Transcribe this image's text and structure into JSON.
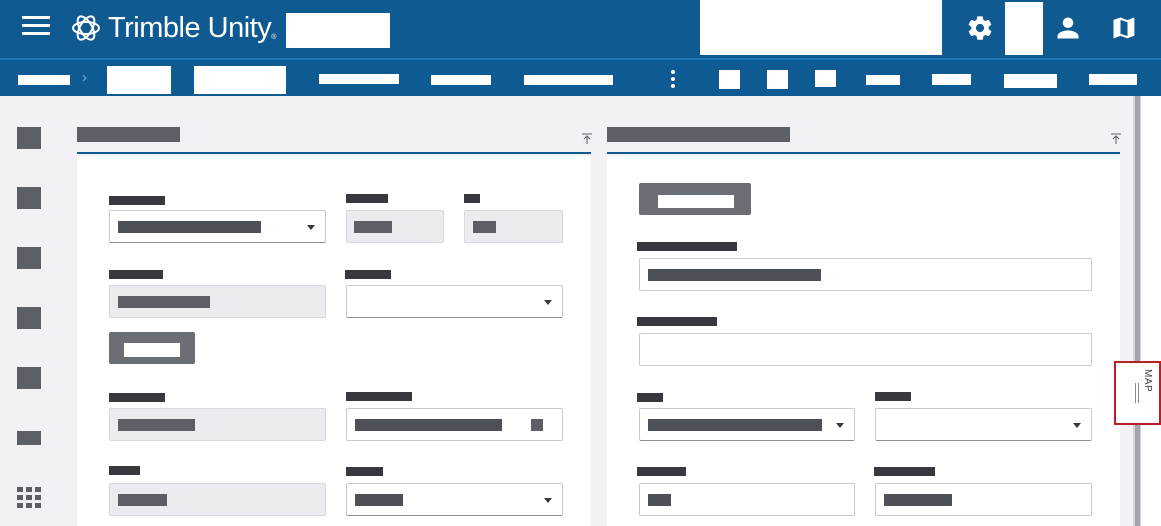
{
  "app": {
    "brand": "Trimble Unity",
    "trademark": "®"
  },
  "map_tab": {
    "label": "MAP"
  },
  "colors": {
    "header_bg": "#0e5a91",
    "accent_line": "#0e5a91",
    "highlight_border": "#b82025",
    "icon_gray": "#5c5f66"
  },
  "icons": {
    "menu": "hamburger-icon",
    "settings": "gear-icon",
    "user": "user-icon",
    "map": "map-icon",
    "apps": "grid-icon",
    "collapse": "collapse-up-icon",
    "breadcrumb_separator": "chevron-right-icon"
  },
  "breadcrumb": {
    "separator": "›"
  }
}
